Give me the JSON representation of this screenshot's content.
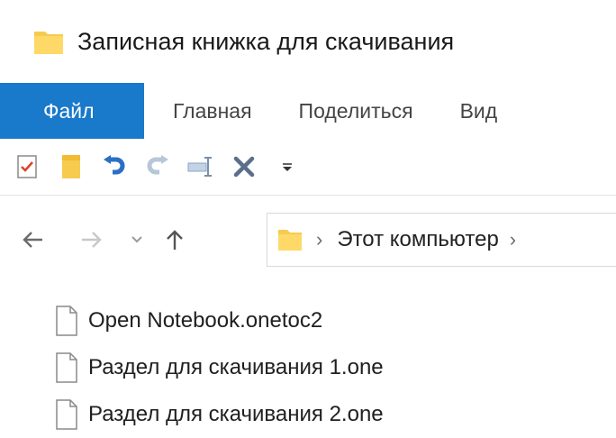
{
  "window": {
    "title": "Записная книжка для скачивания"
  },
  "ribbon": {
    "tabs": [
      {
        "label": "Файл",
        "active": true
      },
      {
        "label": "Главная"
      },
      {
        "label": "Поделиться"
      },
      {
        "label": "Вид"
      }
    ]
  },
  "quick_access": {
    "icons": [
      "properties-icon",
      "new-folder-icon",
      "undo-icon",
      "redo-icon",
      "rename-icon",
      "delete-icon",
      "customize-dropdown-icon"
    ]
  },
  "navigation": {
    "breadcrumb": [
      "Этот компьютер"
    ]
  },
  "files": [
    {
      "name": "Open Notebook.onetoc2"
    },
    {
      "name": "Раздел для скачивания 1.one"
    },
    {
      "name": "Раздел для скачивания 2.one"
    }
  ],
  "colors": {
    "accent": "#1979ca",
    "folder": "#f6cb4f"
  }
}
